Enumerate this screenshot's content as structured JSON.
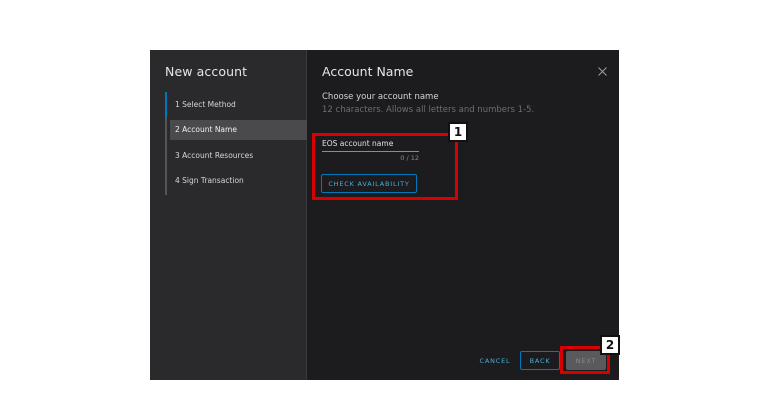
{
  "sidebar": {
    "title": "New account",
    "steps": [
      {
        "label": "1 Select Method",
        "active": false
      },
      {
        "label": "2 Account Name",
        "active": true
      },
      {
        "label": "3 Account Resources",
        "active": false
      },
      {
        "label": "4 Sign Transaction",
        "active": false
      }
    ]
  },
  "main": {
    "title": "Account Name",
    "subtitle": "Choose your account name",
    "hint": "12 characters. Allows all letters and numbers 1-5.",
    "field": {
      "placeholder": "EOS account name",
      "value": "",
      "counter": "0 / 12"
    },
    "check_button": "CHECK AVAILABILITY"
  },
  "footer": {
    "cancel_label": "CANCEL",
    "back_label": "BACK",
    "next_label": "NEXT"
  },
  "annotations": {
    "marker_1": "1",
    "marker_2": "2"
  },
  "icons": {
    "close": "close-icon"
  },
  "colors": {
    "accent": "#0079b8",
    "accent_text": "#49afd9",
    "callout": "#d80000",
    "dialog_bg": "#1c1c1e",
    "sidebar_bg": "#2a2a2c"
  }
}
